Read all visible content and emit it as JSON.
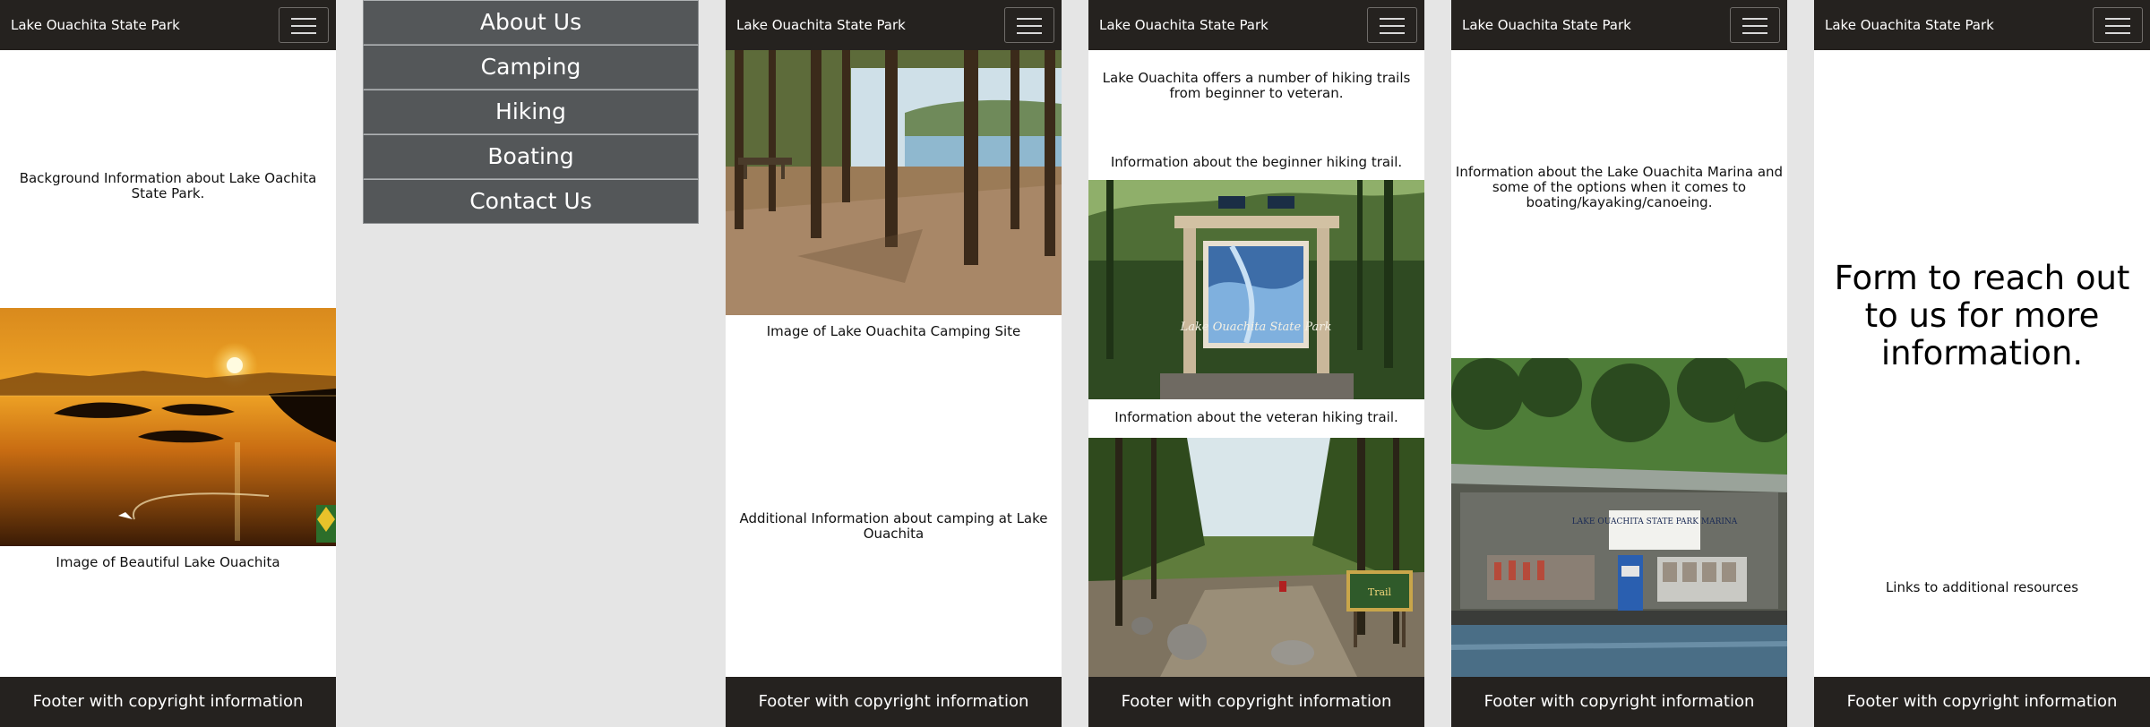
{
  "app": {
    "brand": "Lake Ouachita State Park"
  },
  "footer": {
    "text": "Footer with copyright information"
  },
  "frames": {
    "about": {
      "background_text": "Background Information about Lake Oachita State Park.",
      "image_caption": "Image of Beautiful Lake Ouachita"
    },
    "menu": {
      "items": [
        "About Us",
        "Camping",
        "Hiking",
        "Boating",
        "Contact Us"
      ]
    },
    "camping": {
      "image_caption": "Image of Lake Ouachita Camping Site",
      "additional_text": "Additional Information about camping at Lake Ouachita"
    },
    "hiking": {
      "intro": "Lake Ouachita offers a number of hiking trails from beginner to veteran.",
      "beginner_text": "Information about the beginner hiking trail.",
      "sign_text": "Lake Ouachita State Park",
      "veteran_text": "Information about the veteran hiking trail.",
      "trail_sign_text": "Trail"
    },
    "boating": {
      "info": "Information about the Lake Ouachita Marina and some of the options when it comes to boating/kayaking/canoeing.",
      "marina_sign": "LAKE OUACHITA STATE PARK MARINA"
    },
    "contact": {
      "form_text": "Form to reach out to us for more information.",
      "links_text": "Links to additional resources"
    }
  },
  "colors": {
    "bar_dark": "#25221f",
    "page_bg": "#e5e5e5",
    "menu_item": "#545759",
    "text": "#111111"
  },
  "icons": [
    "hamburger-menu-icon"
  ]
}
